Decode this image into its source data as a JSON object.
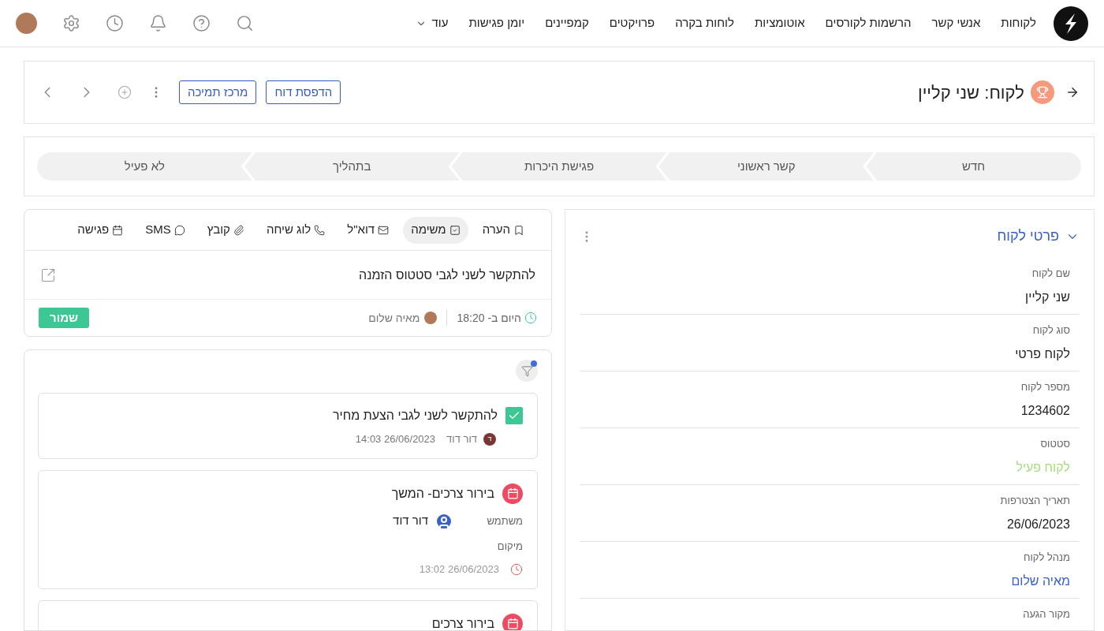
{
  "nav": {
    "items": [
      {
        "label": "לקוחות"
      },
      {
        "label": "אנשי קשר"
      },
      {
        "label": "הרשמות לקורסים"
      },
      {
        "label": "אוטומציות"
      },
      {
        "label": "לוחות בקרה"
      },
      {
        "label": "פרויקטים"
      },
      {
        "label": "קמפיינים"
      },
      {
        "label": "יומן פגישות"
      },
      {
        "label": "עוד",
        "kind": "more"
      }
    ]
  },
  "header": {
    "title": "לקוח: שני קליין",
    "buttons": [
      "הדפסת דוח",
      "מרכז תמיכה"
    ]
  },
  "pipeline": [
    "חדש",
    "קשר ראשוני",
    "פגישת היכרות",
    "בתהליך",
    "לא פעיל"
  ],
  "composer": {
    "tabs": [
      {
        "label": "הערה",
        "kind": "note",
        "selected": false
      },
      {
        "label": "משימה",
        "kind": "task",
        "selected": true
      },
      {
        "label": "דוא\"ל",
        "kind": "email",
        "selected": false
      },
      {
        "label": "לוג שיחה",
        "kind": "call",
        "selected": false
      },
      {
        "label": "קובץ",
        "kind": "file",
        "selected": false
      },
      {
        "label": "SMS",
        "kind": "sms",
        "selected": false
      },
      {
        "label": "פגישה",
        "kind": "meeting",
        "selected": false
      }
    ],
    "value": "להתקשר לשני לגבי סטטוס הזמנה",
    "due": "היום ב- 18:20",
    "owner": "מאיה שלום",
    "save": "שמור"
  },
  "activities": {
    "filter_active": true,
    "items": [
      {
        "kind": "task",
        "checked": true,
        "title": "להתקשר לשני לגבי הצעת מחיר",
        "author_initial": "ד",
        "author": "דור דוד",
        "date": "26/06/2023 14:03"
      },
      {
        "kind": "meeting",
        "title": "בירור צרכים- המשך",
        "user_label": "משתמש",
        "user": "דור דוד",
        "location_label": "מיקום",
        "date": "26/06/2023 13:02"
      },
      {
        "kind": "meeting",
        "title": "בירור צרכים"
      }
    ]
  },
  "details": {
    "title": "פרטי לקוח",
    "expanded": true,
    "fields": [
      {
        "label": "שם לקוח",
        "value": "שני קליין",
        "kind": "text"
      },
      {
        "label": "סוג לקוח",
        "value": "לקוח פרטי",
        "kind": "text"
      },
      {
        "label": "מספר לקוח",
        "value": "1234602",
        "kind": "text"
      },
      {
        "label": "סטטוס",
        "value": "לקוח פעיל",
        "kind": "status"
      },
      {
        "label": "תאריך הצטרפות",
        "value": "26/06/2023",
        "kind": "text"
      },
      {
        "label": "מנהל לקוח",
        "value": "מאיה שלום",
        "kind": "link"
      },
      {
        "label": "מקור הגעה"
      }
    ]
  }
}
